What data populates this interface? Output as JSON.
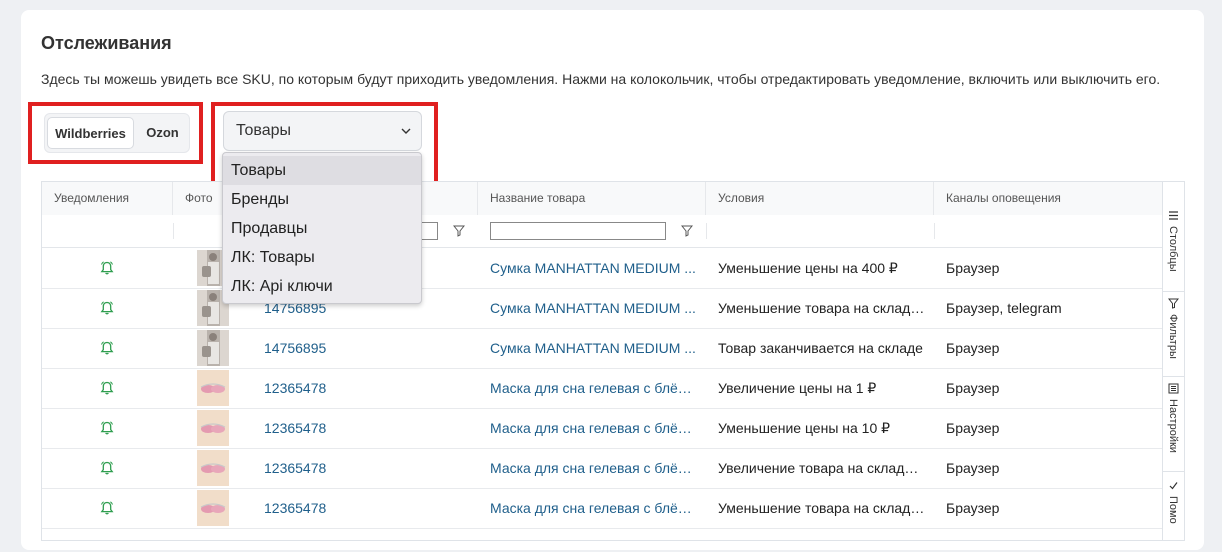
{
  "page": {
    "title": "Отслеживания",
    "description": "Здесь ты можешь увидеть все SKU, по которым будут приходить уведомления. Нажми на колокольчик, чтобы отредактировать уведомление, включить или выключить его."
  },
  "marketplace": {
    "options": [
      "Wildberries",
      "Ozon"
    ],
    "active": "Wildberries"
  },
  "type_select": {
    "value": "Товары",
    "options": [
      "Товары",
      "Бренды",
      "Продавцы",
      "ЛК: Товары",
      "ЛК: Api ключи"
    ]
  },
  "table": {
    "columns": [
      "Уведомления",
      "Фото",
      "",
      "Название товара",
      "Условия",
      "Каналы оповещения"
    ],
    "rows": [
      {
        "sku": "14756895",
        "name": "Сумка MANHATTAN MEDIUM ...",
        "condition": "Уменьшение цены на 400 ₽",
        "channels": "Браузер",
        "photo": "bag"
      },
      {
        "sku": "14756895",
        "name": "Сумка MANHATTAN MEDIUM ...",
        "condition": "Уменьшение товара на складе...",
        "channels": "Браузер, telegram",
        "photo": "bag"
      },
      {
        "sku": "14756895",
        "name": "Сумка MANHATTAN MEDIUM ...",
        "condition": "Товар заканчивается на складе",
        "channels": "Браузер",
        "photo": "bag"
      },
      {
        "sku": "12365478",
        "name": "Маска для сна гелевая с блёст...",
        "condition": "Увеличение цены на 1 ₽",
        "channels": "Браузер",
        "photo": "mask"
      },
      {
        "sku": "12365478",
        "name": "Маска для сна гелевая с блёст...",
        "condition": "Уменьшение цены на 10 ₽",
        "channels": "Браузер",
        "photo": "mask"
      },
      {
        "sku": "12365478",
        "name": "Маска для сна гелевая с блёст...",
        "condition": "Увеличение товара на складе ...",
        "channels": "Браузер",
        "photo": "mask"
      },
      {
        "sku": "12365478",
        "name": "Маска для сна гелевая с блёст...",
        "condition": "Уменьшение товара на складе ...",
        "channels": "Браузер",
        "photo": "mask"
      }
    ]
  },
  "side_tabs": [
    "Столбцы",
    "Фильтры",
    "Настройки",
    "Помо"
  ],
  "colors": {
    "accent_green": "#2e9e4f",
    "link": "#1f5f8b",
    "highlight_red": "#e02020"
  }
}
